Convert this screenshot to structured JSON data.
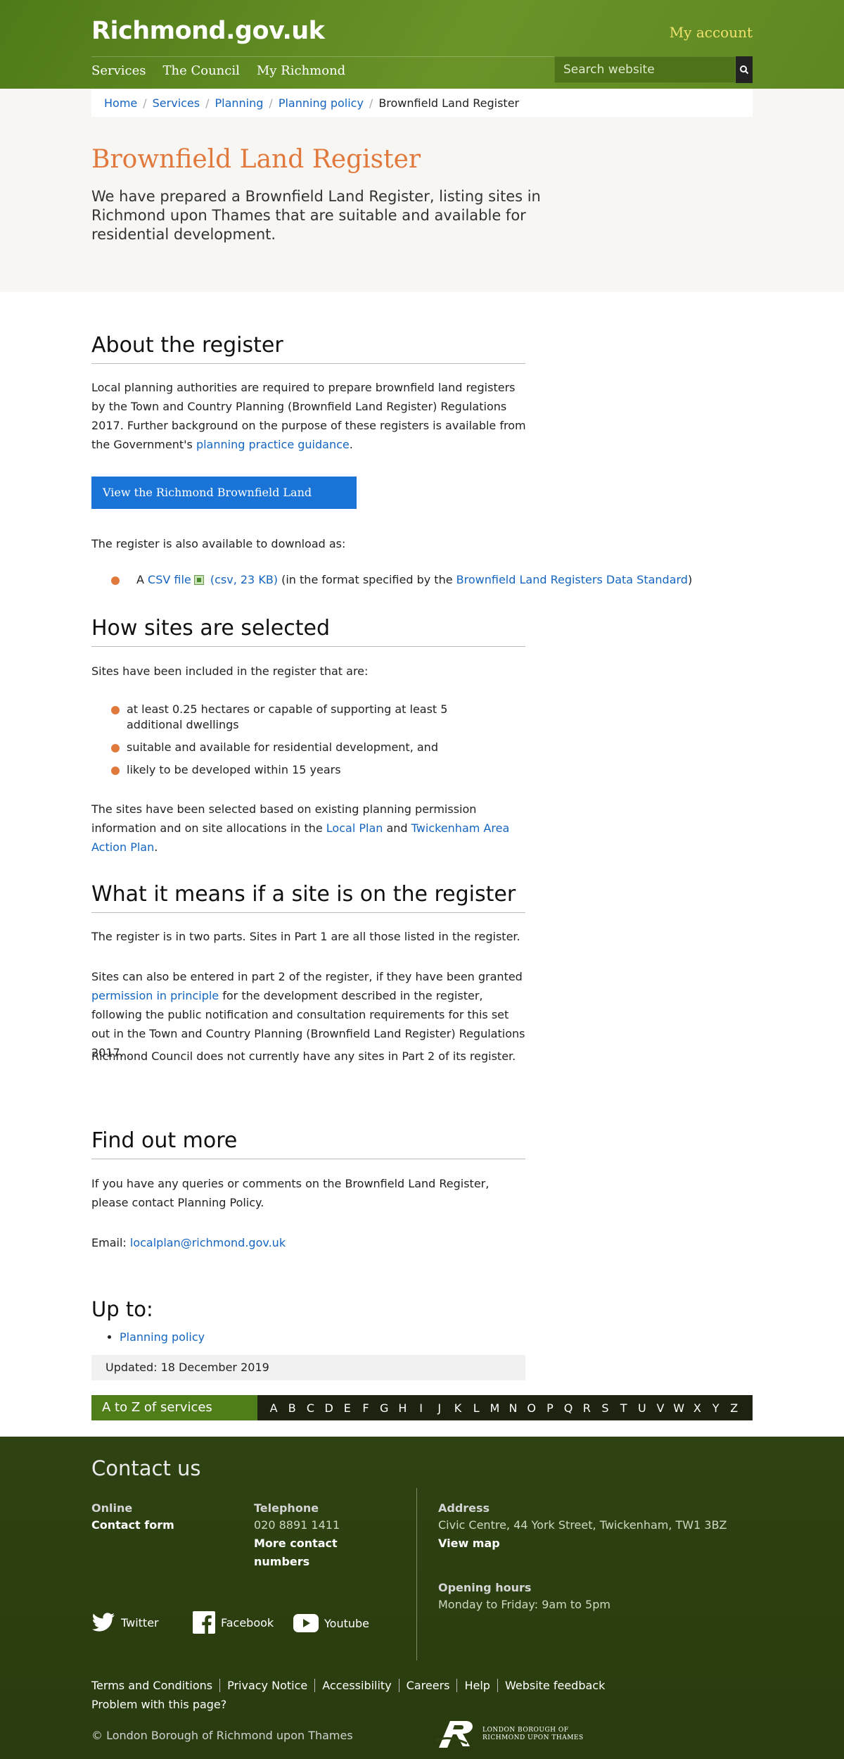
{
  "header": {
    "logo": "Richmond.gov.uk",
    "my_account": "My account",
    "nav": [
      "Services",
      "The Council",
      "My Richmond"
    ],
    "search_placeholder": "Search website"
  },
  "breadcrumb": {
    "items": [
      "Home",
      "Services",
      "Planning",
      "Planning policy"
    ],
    "current": "Brownfield Land Register"
  },
  "hero": {
    "title": "Brownfield Land Register",
    "lead": "We have prepared a Brownfield Land Register, listing sites in Richmond upon Thames that are suitable and available for residential development."
  },
  "about": {
    "heading": "About the register",
    "para_1": "Local planning authorities are required to prepare brownfield land registers by the Town and Country Planning (Brownfield Land Register) Regulations 2017. Further background on the purpose of these registers is available from the Government's ",
    "para_1_link": "planning practice guidance",
    "para_1_end": ".",
    "button": "View the Richmond Brownfield Land Register",
    "download_intro": "The register is also available to download as:",
    "download_prefix": "A ",
    "download_link": "CSV file",
    "download_size": "(csv, 23 KB)",
    "download_mid": " (in the format specified by the ",
    "download_standard": "Brownfield Land Registers Data Standard",
    "download_end": ")"
  },
  "selection": {
    "heading": "How sites are selected",
    "intro": "Sites have been included in the register that are:",
    "bullets": [
      "at least 0.25 hectares or capable of supporting at least 5 additional dwellings",
      "suitable and available for residential development, and",
      "likely to be developed within 15 years"
    ],
    "para_start": "The sites have been selected based on existing planning permission information and on site allocations in the ",
    "link_local_plan": "Local Plan",
    "para_and": " and ",
    "link_twickenham": "Twickenham Area Action Plan",
    "para_end": "."
  },
  "meaning": {
    "heading": "What it means if a site is on the register",
    "para_1": "The register is in two parts. Sites in Part 1 are all those listed in the register.",
    "para_2_start": "Sites can also be entered in part 2 of the register, if they have been granted ",
    "para_2_link": "permission in principle",
    "para_2_end": " for the development described in the register, following the public notification and consultation requirements for this set out in the Town and Country Planning (Brownfield Land Register) Regulations 2017.",
    "para_3": "Richmond Council does not currently have any sites in Part 2 of its register."
  },
  "find_out": {
    "heading": "Find out more",
    "para": "If you have any queries or comments on the Brownfield Land Register, please contact Planning Policy.",
    "email_label": "Email: ",
    "email": "localplan@richmond.gov.uk"
  },
  "up_to": {
    "heading": "Up to:",
    "link": "Planning policy",
    "updated": "Updated: 18 December 2019"
  },
  "atoz": {
    "label": "A to Z of services",
    "letters": [
      "A",
      "B",
      "C",
      "D",
      "E",
      "F",
      "G",
      "H",
      "I",
      "J",
      "K",
      "L",
      "M",
      "N",
      "O",
      "P",
      "Q",
      "R",
      "S",
      "T",
      "U",
      "V",
      "W",
      "X",
      "Y",
      "Z"
    ]
  },
  "footer": {
    "title": "Contact us",
    "online_label": "Online",
    "contact_form": "Contact form",
    "telephone_label": "Telephone",
    "telephone": "020 8891 1411",
    "more_contact": "More contact numbers",
    "address_label": "Address",
    "address": "Civic Centre, 44 York Street, Twickenham, TW1 3BZ",
    "view_map": "View map",
    "hours_label": "Opening hours",
    "hours": "Monday to Friday: 9am to 5pm",
    "social": [
      "Twitter",
      "Facebook",
      "Youtube"
    ],
    "links": [
      "Terms and Conditions",
      "Privacy Notice",
      "Accessibility",
      "Careers",
      "Help",
      "Website feedback",
      "Problem with this page?"
    ],
    "copyright": "© London Borough of Richmond upon Thames",
    "crest_text": "LONDON BOROUGH OF RICHMOND UPON THAMES"
  },
  "colors": {
    "header_green": "#5e8722",
    "accent_orange": "#e1793d",
    "link_blue": "#1565c0",
    "button_blue": "#1a73d6",
    "footer_green": "#2c3f10"
  }
}
